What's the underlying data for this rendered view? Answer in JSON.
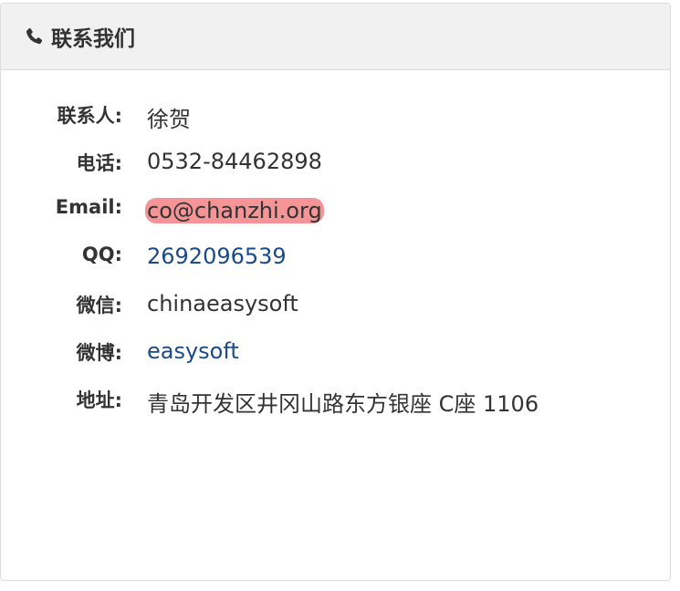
{
  "panel": {
    "title": "联系我们",
    "icon": "phone-icon"
  },
  "contacts": [
    {
      "label": "联系人:",
      "value": "徐贺",
      "style": "text"
    },
    {
      "label": "电话:",
      "value": "0532-84462898",
      "style": "text"
    },
    {
      "label": "Email:",
      "value": "co@chanzhi.org",
      "style": "highlight"
    },
    {
      "label": "QQ:",
      "value": "2692096539",
      "style": "link"
    },
    {
      "label": "微信:",
      "value": "chinaeasysoft",
      "style": "text"
    },
    {
      "label": "微博:",
      "value": "easysoft",
      "style": "link"
    },
    {
      "label": "地址:",
      "value": "青岛开发区井冈山路东方银座 C座 1106",
      "style": "text"
    }
  ],
  "colors": {
    "link": "#1a4a8a",
    "highlight": "#f49497",
    "heading_bg": "#f1f1f1"
  }
}
